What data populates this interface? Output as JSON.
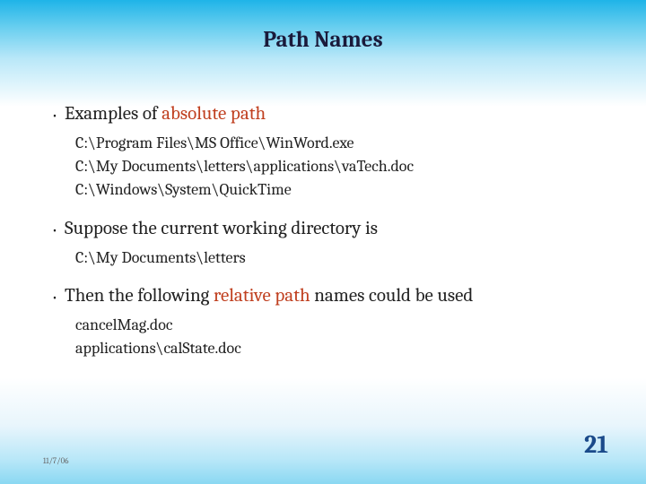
{
  "title": "Path Names",
  "bullets": [
    {
      "text_pre": "Examples of ",
      "highlight": "absolute path",
      "text_post": "",
      "subs": [
        "C:\\Program Files\\MS Office\\WinWord.exe",
        "C:\\My Documents\\letters\\applications\\vaTech.doc",
        "C:\\Windows\\System\\QuickTime"
      ]
    },
    {
      "text_pre": "Suppose the current working directory is",
      "highlight": "",
      "text_post": "",
      "subs": [
        "C:\\My Documents\\letters"
      ]
    },
    {
      "text_pre": "Then the following ",
      "highlight": "relative path",
      "text_post": " names could be used",
      "subs": [
        "cancelMag.doc",
        "applications\\calState.doc"
      ]
    }
  ],
  "footer_date": "11/7/06",
  "page_number": "21"
}
